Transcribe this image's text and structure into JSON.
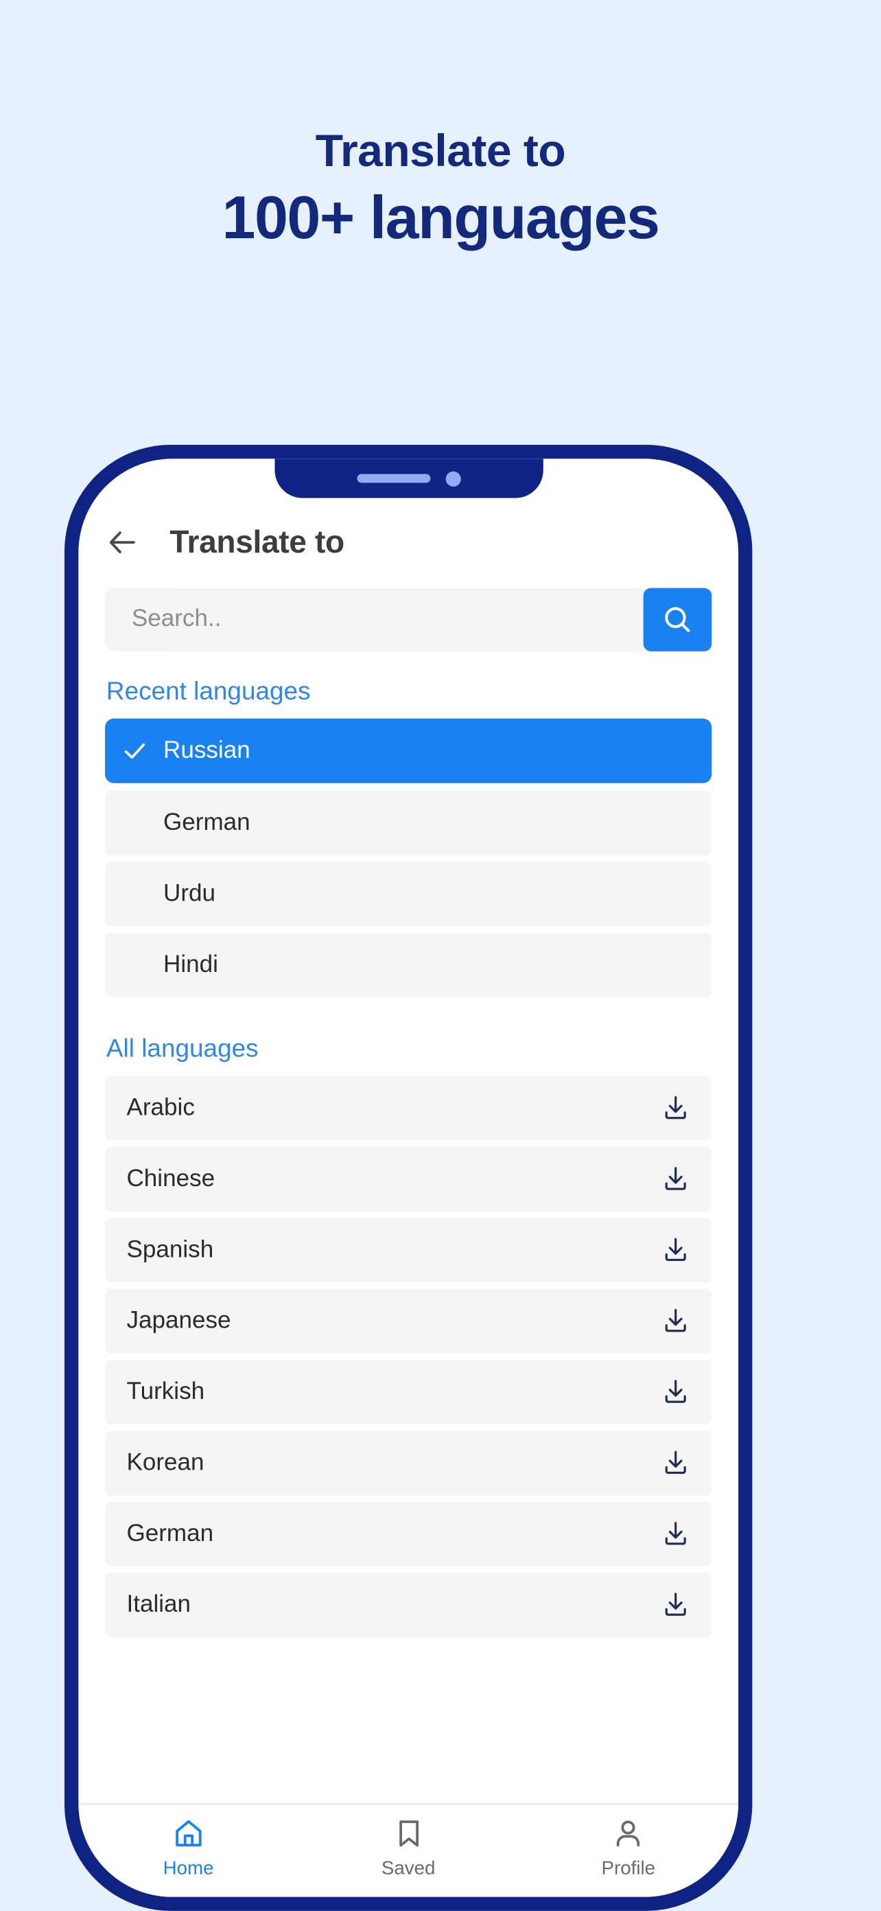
{
  "promo": {
    "line1": "Translate to",
    "line2": "100+ languages",
    "text_color": "#132a7c",
    "background": "#e6f1fd"
  },
  "phone": {
    "frame_color": "#0e2384",
    "notch": {
      "speaker_icon": "speaker-grill",
      "camera_icon": "front-camera-dot",
      "accent_color": "#93abf4"
    }
  },
  "app": {
    "header": {
      "back_icon": "back-arrow-icon",
      "title": "Translate to"
    },
    "search": {
      "placeholder": "Search..",
      "value": "",
      "button_icon": "search-icon",
      "button_color": "#1a82f0"
    },
    "sections": [
      {
        "id": "recent",
        "title": "Recent languages",
        "title_color": "#2f87e8",
        "items": [
          {
            "name": "Russian",
            "selected": true,
            "check_icon": "check-icon"
          },
          {
            "name": "German",
            "selected": false
          },
          {
            "name": "Urdu",
            "selected": false
          },
          {
            "name": "Hindi",
            "selected": false
          }
        ]
      },
      {
        "id": "all",
        "title": "All languages",
        "title_color": "#2f87e8",
        "items": [
          {
            "name": "Arabic",
            "download_icon": "download-icon"
          },
          {
            "name": "Chinese",
            "download_icon": "download-icon"
          },
          {
            "name": "Spanish",
            "download_icon": "download-icon"
          },
          {
            "name": "Japanese",
            "download_icon": "download-icon"
          },
          {
            "name": "Turkish",
            "download_icon": "download-icon"
          },
          {
            "name": "Korean",
            "download_icon": "download-icon"
          },
          {
            "name": "German",
            "download_icon": "download-icon"
          },
          {
            "name": "Italian",
            "download_icon": "download-icon"
          }
        ]
      }
    ],
    "tabbar": {
      "active_color": "#1a82f0",
      "inactive_color": "#6a6a6a",
      "tabs": [
        {
          "label": "Home",
          "icon": "home-icon",
          "active": true
        },
        {
          "label": "Saved",
          "icon": "bookmark-icon",
          "active": false
        },
        {
          "label": "Profile",
          "icon": "person-icon",
          "active": false
        }
      ]
    }
  }
}
